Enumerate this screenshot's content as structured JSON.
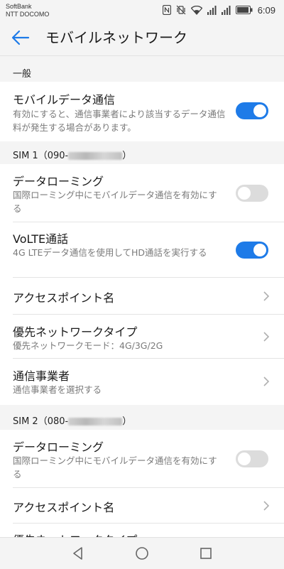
{
  "status_bar": {
    "carrier_1": "SoftBank",
    "carrier_2": "NTT DOCOMO",
    "time": "6:09"
  },
  "header": {
    "title": "モバイルネットワーク"
  },
  "sections": {
    "general": {
      "label": "一般",
      "mobile_data": {
        "title": "モバイルデータ通信",
        "subtitle": "有効にすると、通信事業者により該当するデータ通信料が発生する場合があります。",
        "toggle": "on"
      }
    },
    "sim1": {
      "label_prefix": "SIM 1（090-",
      "label_suffix": "）",
      "data_roaming": {
        "title": "データローミング",
        "subtitle": "国際ローミング中にモバイルデータ通信を有効にする",
        "toggle": "off"
      },
      "volte": {
        "title": "VoLTE通話",
        "subtitle": "4G LTEデータ通信を使用してHD通話を実行する",
        "toggle": "on"
      },
      "apn": {
        "title": "アクセスポイント名"
      },
      "network_type": {
        "title": "優先ネットワークタイプ",
        "subtitle": "優先ネットワークモード：4G/3G/2G"
      },
      "carrier": {
        "title": "通信事業者",
        "subtitle": "通信事業者を選択する"
      }
    },
    "sim2": {
      "label_prefix": "SIM 2（080-",
      "label_suffix": "）",
      "data_roaming": {
        "title": "データローミング",
        "subtitle": "国際ローミング中にモバイルデータ通信を有効にする",
        "toggle": "off"
      },
      "apn": {
        "title": "アクセスポイント名"
      },
      "network_type": {
        "title": "優先ネットワークタイプ"
      }
    }
  },
  "colors": {
    "accent": "#1e7be8",
    "toggle_off": "#dcdcdc",
    "background": "#f4f4f4"
  }
}
